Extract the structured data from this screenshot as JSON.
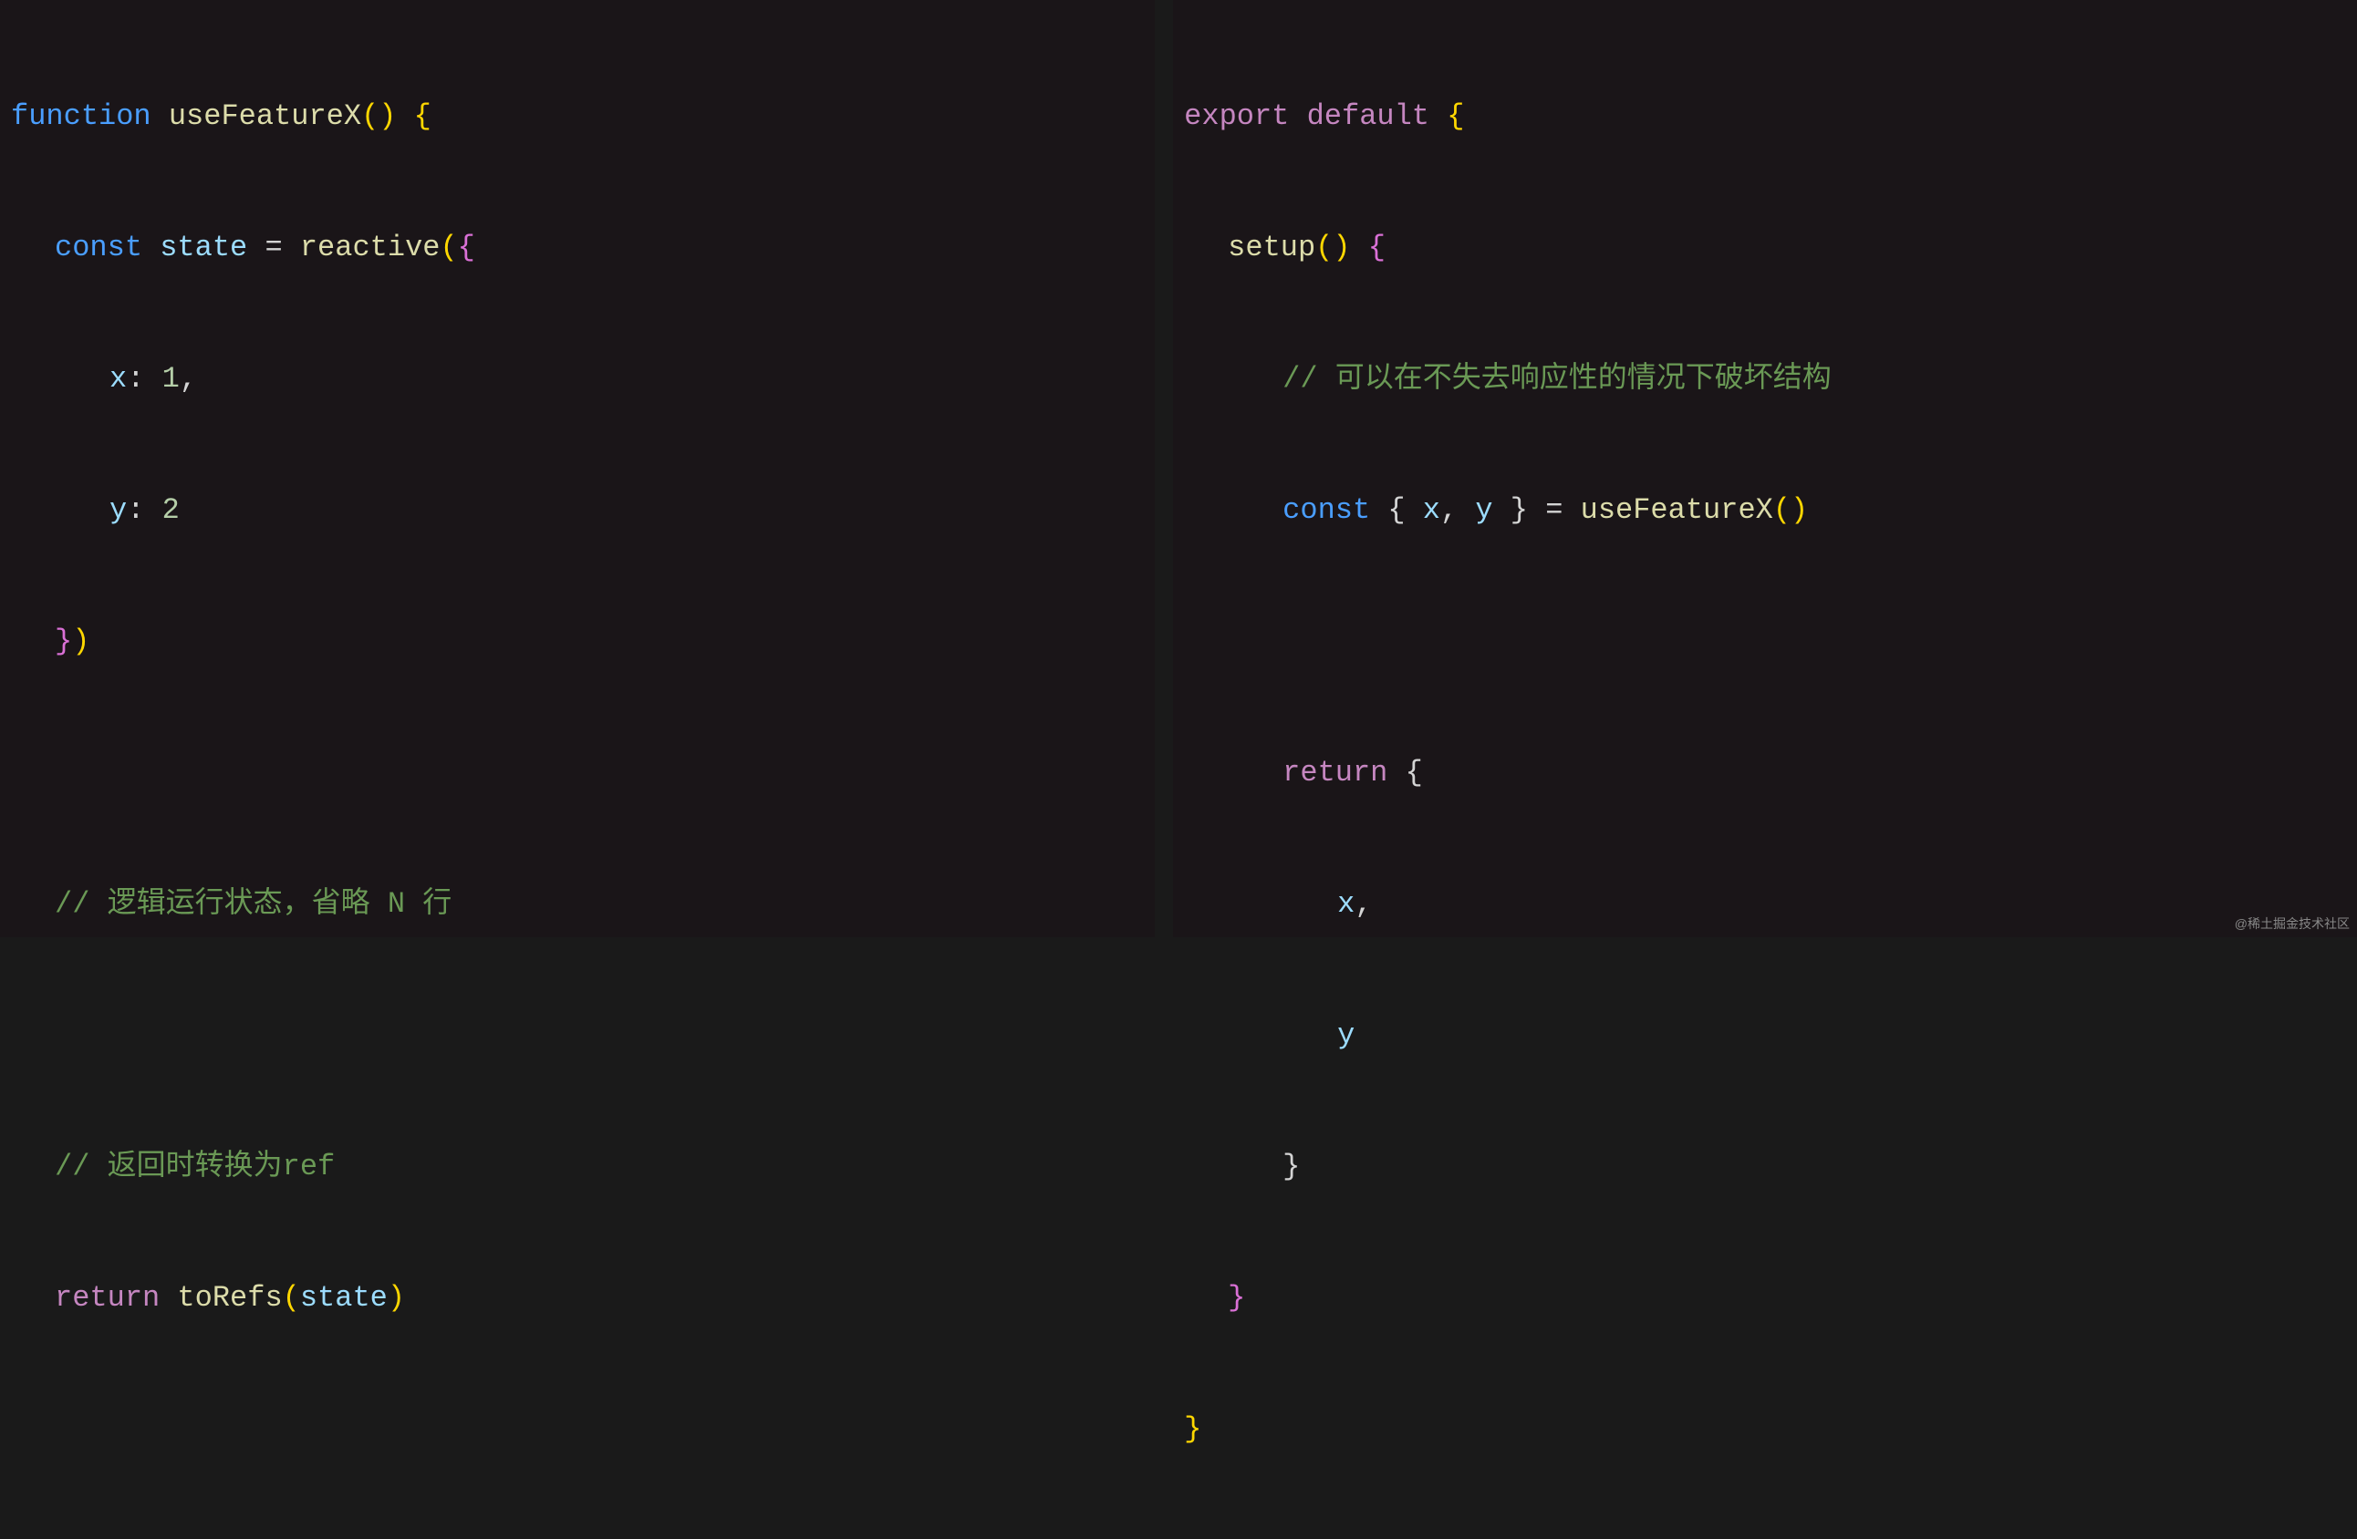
{
  "left": {
    "l1": {
      "function": "function",
      "name": "useFeatureX",
      "open": "() {"
    },
    "l2": {
      "const": "const",
      "var": "state",
      "eq": " = ",
      "fn": "reactive",
      "open": "({"
    },
    "l3": {
      "prop": "x",
      "colon": ": ",
      "val": "1",
      "comma": ","
    },
    "l4": {
      "prop": "y",
      "colon": ": ",
      "val": "2"
    },
    "l5": {
      "close": "})"
    },
    "l6": "",
    "l7": {
      "comment": "// 逻辑运行状态，省略 N 行"
    },
    "l8": "",
    "l9": {
      "comment": "// 返回时转换为ref"
    },
    "l10": {
      "return": "return",
      "fn": "toRefs",
      "open": "(",
      "var": "state",
      "close": ")"
    }
  },
  "right": {
    "l1": {
      "export": "export",
      "default": "default",
      "open": " {"
    },
    "l2": {
      "fn": "setup",
      "open": "() {"
    },
    "l3": {
      "comment": "// 可以在不失去响应性的情况下破坏结构"
    },
    "l4": {
      "const": "const",
      "open": "{ ",
      "x": "x",
      "comma": ", ",
      "y": "y",
      "close": " }",
      "eq": " = ",
      "fn": "useFeatureX",
      "call": "()"
    },
    "l5": "",
    "l6": {
      "return": "return",
      "open": " {"
    },
    "l7": {
      "prop": "x",
      "comma": ","
    },
    "l8": {
      "prop": "y"
    },
    "l9": {
      "close": "}"
    },
    "l10": {
      "close": "}"
    },
    "l11": {
      "close": "}"
    }
  },
  "watermark": "@稀土掘金技术社区"
}
